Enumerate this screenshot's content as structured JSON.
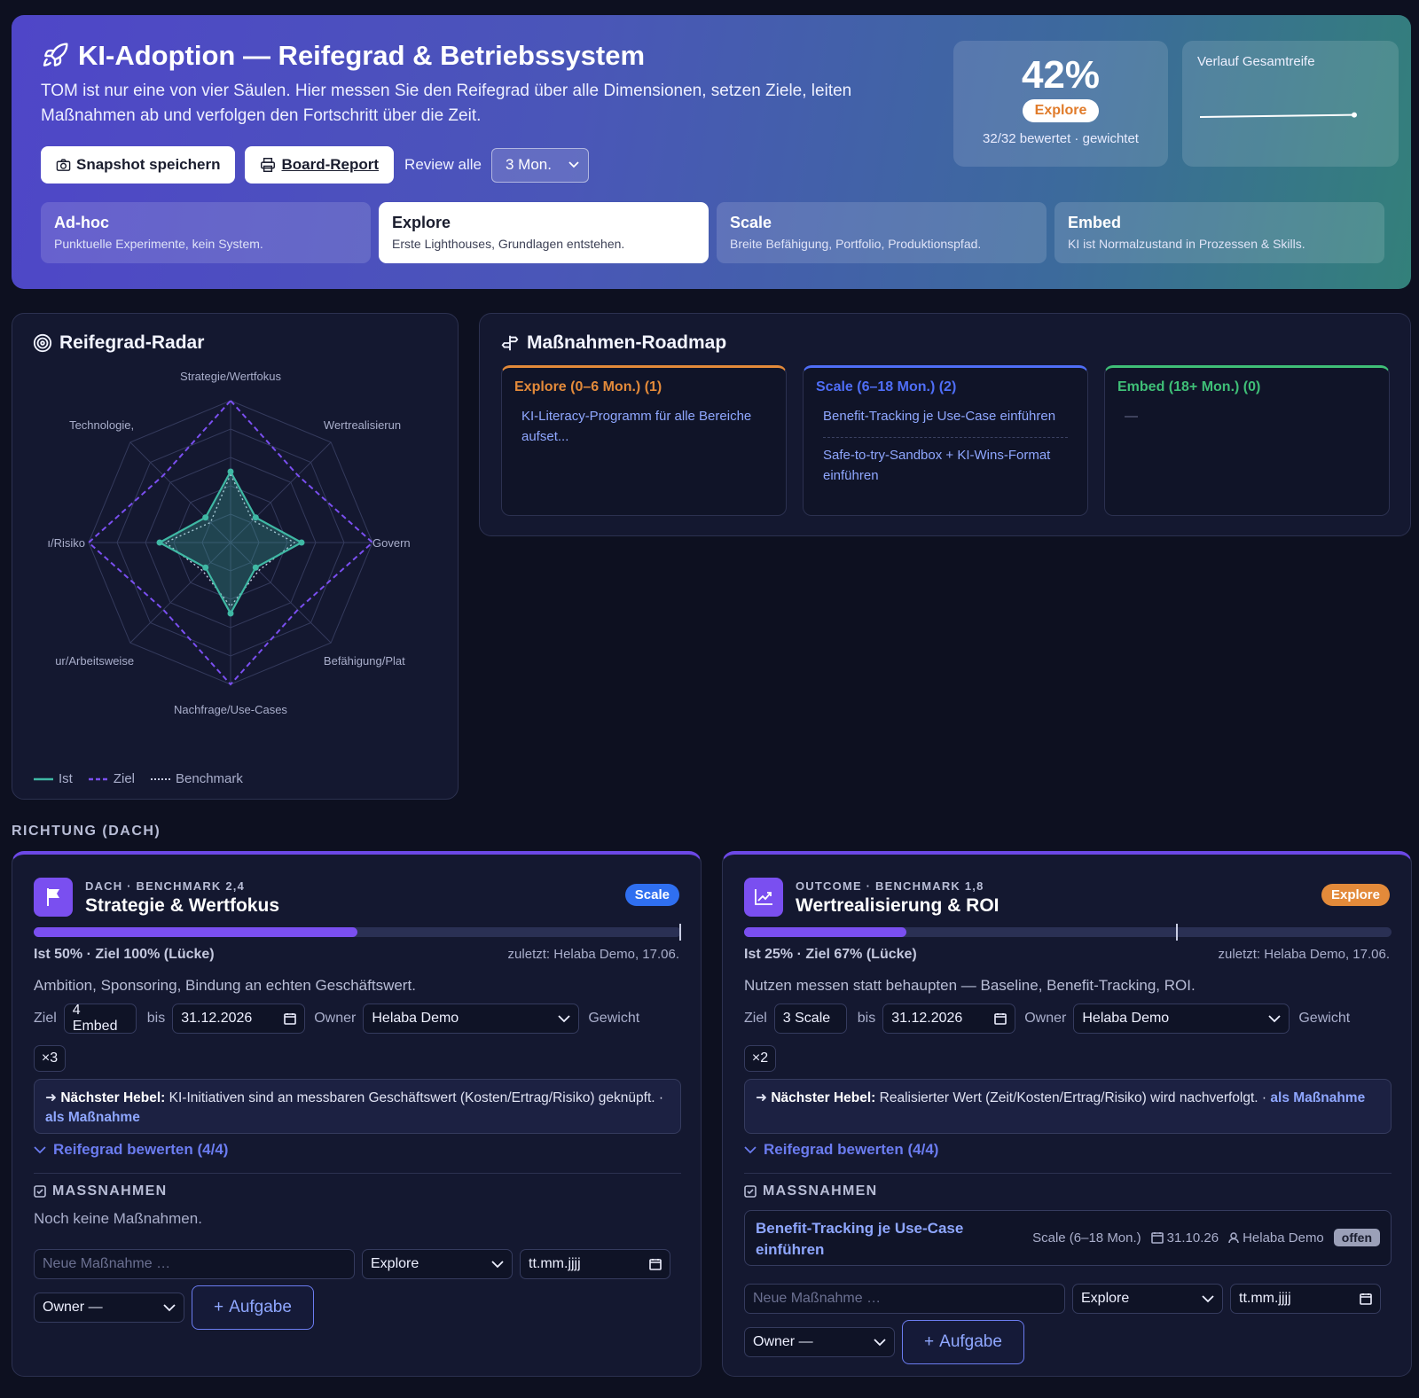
{
  "hero": {
    "title": "KI-Adoption — Reifegrad & Betriebssystem",
    "description": "TOM ist nur eine von vier Säulen. Hier messen Sie den Reifegrad über alle Dimensionen, setzen Ziele, leiten Maßnahmen ab und verfolgen den Fortschritt über die Zeit.",
    "snapshot_button": "Snapshot speichern",
    "board_button": "Board-Report",
    "review_label": "Review alle",
    "review_value": "3 Mon.",
    "kpi": {
      "value": "42%",
      "badge": "Explore",
      "sub": "32/32 bewertet · gewichtet"
    },
    "trend_label": "Verlauf Gesamtreife",
    "trend_values": [
      40,
      42
    ],
    "stages": [
      {
        "name": "Ad-hoc",
        "desc": "Punktuelle Experimente, kein System.",
        "active": false
      },
      {
        "name": "Explore",
        "desc": "Erste Lighthouses, Grundlagen entstehen.",
        "active": true
      },
      {
        "name": "Scale",
        "desc": "Breite Befähigung, Portfolio, Produktionspfad.",
        "active": false
      },
      {
        "name": "Embed",
        "desc": "KI ist Normalzustand in Prozessen & Skills.",
        "active": false
      }
    ]
  },
  "radar": {
    "title": "Reifegrad-Radar",
    "axes": [
      "Strategie/Wertfokus",
      "Wertrealisierung",
      "Governance",
      "Befähigung/Plattform",
      "Nachfrage/Use-Cases",
      "Kultur/Arbeitsweise",
      "Daten/Risiko",
      "Technologie"
    ],
    "axis_labels": [
      "Strategie/Wertfokus",
      "Wertrealisierun",
      "Govern",
      "Befähigung/Plat",
      "Nachfrage/Use-Cases",
      "ur/Arbeitsweise",
      "ı/Risiko",
      "Technologie,"
    ],
    "ist": [
      50,
      25,
      50,
      25,
      50,
      25,
      50,
      25
    ],
    "ziel": [
      100,
      67,
      100,
      67,
      100,
      67,
      100,
      67
    ],
    "benchmark": [
      48,
      22,
      45,
      28,
      45,
      28,
      46,
      20
    ],
    "legend": {
      "ist": "Ist",
      "ziel": "Ziel",
      "benchmark": "Benchmark"
    },
    "colors": {
      "ist": "#3fb8a4",
      "ziel": "#7a4ff0",
      "benchmark": "#c9cde3"
    }
  },
  "roadmap": {
    "title": "Maßnahmen-Roadmap",
    "columns": [
      {
        "head": "Explore (0–6 Mon.) (1)",
        "color": "#e38a3a",
        "items": [
          "KI-Literacy-Programm für alle Bereiche aufset..."
        ]
      },
      {
        "head": "Scale (6–18 Mon.) (2)",
        "color": "#4f6ef7",
        "items": [
          "Benefit-Tracking je Use-Case einführen",
          "Safe-to-try-Sandbox + KI-Wins-Format einführen"
        ]
      },
      {
        "head": "Embed (18+ Mon.) (0)",
        "color": "#3fbf77",
        "items": [
          "—"
        ]
      }
    ]
  },
  "section_label": "RICHTUNG (DACH)",
  "cards": [
    {
      "kicker": "DACH · BENCHMARK 2,4",
      "title": "Strategie & Wertfokus",
      "badge": "Scale",
      "badge_color": "#2f6ff0",
      "ist_pct": 50,
      "ziel_pct": 100,
      "stats": "Ist 50% · Ziel 100% (Lücke)",
      "last": "zuletzt: Helaba Demo, 17.06.",
      "desc": "Ambition, Sponsoring, Bindung an echten Geschäftswert.",
      "ziel_label": "Ziel",
      "ziel_value": "4 Embed",
      "bis_label": "bis",
      "date": "31.12.2026",
      "owner_label": "Owner",
      "owner": "Helaba Demo",
      "gewicht_label": "Gewicht",
      "weight": "×3",
      "lever_label": "Nächster Hebel:",
      "lever_text": "KI-Initiativen sind an messbaren Geschäftswert (Kosten/Ertrag/Risiko) geknüpft. ·",
      "lever_link": "als Maßnahme",
      "rate": "Reifegrad bewerten (4/4)",
      "mass_label": "MASSNAHMEN",
      "empty": "Noch keine Maßnahmen.",
      "new_placeholder": "Neue Maßnahme …",
      "new_stage": "Explore",
      "new_date": "tt.mm.jjjj",
      "new_owner": "Owner —",
      "add_button": "Aufgabe"
    },
    {
      "kicker": "OUTCOME · BENCHMARK 1,8",
      "title": "Wertrealisierung & ROI",
      "badge": "Explore",
      "badge_color": "#e38a3a",
      "ist_pct": 25,
      "ziel_pct": 67,
      "stats": "Ist 25% · Ziel 67% (Lücke)",
      "last": "zuletzt: Helaba Demo, 17.06.",
      "desc": "Nutzen messen statt behaupten — Baseline, Benefit-Tracking, ROI.",
      "ziel_label": "Ziel",
      "ziel_value": "3 Scale",
      "bis_label": "bis",
      "date": "31.12.2026",
      "owner_label": "Owner",
      "owner": "Helaba Demo",
      "gewicht_label": "Gewicht",
      "weight": "×2",
      "lever_label": "Nächster Hebel:",
      "lever_text": "Realisierter Wert (Zeit/Kosten/Ertrag/Risiko) wird nachverfolgt. ·",
      "lever_link": "als Maßnahme",
      "rate": "Reifegrad bewerten (4/4)",
      "mass_label": "MASSNAHMEN",
      "task": {
        "title": "Benefit-Tracking je Use-Case einführen",
        "stage": "Scale (6–18 Mon.)",
        "date": "31.10.26",
        "owner": "Helaba Demo",
        "status": "offen"
      },
      "new_placeholder": "Neue Maßnahme …",
      "new_stage": "Explore",
      "new_date": "tt.mm.jjjj",
      "new_owner": "Owner —",
      "add_button": "Aufgabe"
    }
  ]
}
